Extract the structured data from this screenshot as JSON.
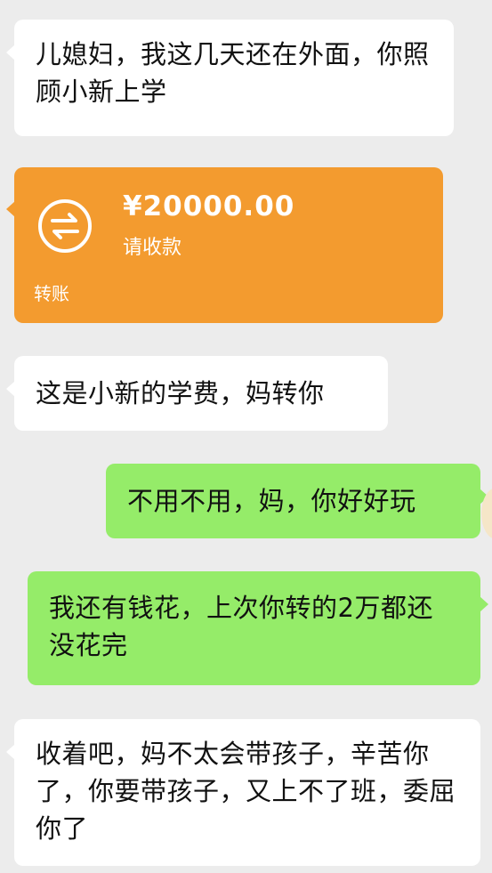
{
  "messages": [
    {
      "side": "left",
      "text": "儿媳妇，我这几天还在外面，你照顾小新上学"
    },
    {
      "side": "left",
      "text": "这是小新的学费，妈转你"
    },
    {
      "side": "right",
      "text": "不用不用，妈，你好好玩"
    },
    {
      "side": "right",
      "text": "我还有钱花，上次你转的2万都还没花完"
    },
    {
      "side": "left",
      "text": "收着吧，妈不太会带孩子，辛苦你了，你要带孩子，又上不了班，委屈你了"
    }
  ],
  "transfer": {
    "amount": "¥20000.00",
    "status": "请收款",
    "label": "转账",
    "icon": "transfer-arrows-icon",
    "color": "#f39b2f"
  },
  "colors": {
    "background": "#ececec",
    "incoming_bubble": "#ffffff",
    "outgoing_bubble": "#95ec69"
  }
}
